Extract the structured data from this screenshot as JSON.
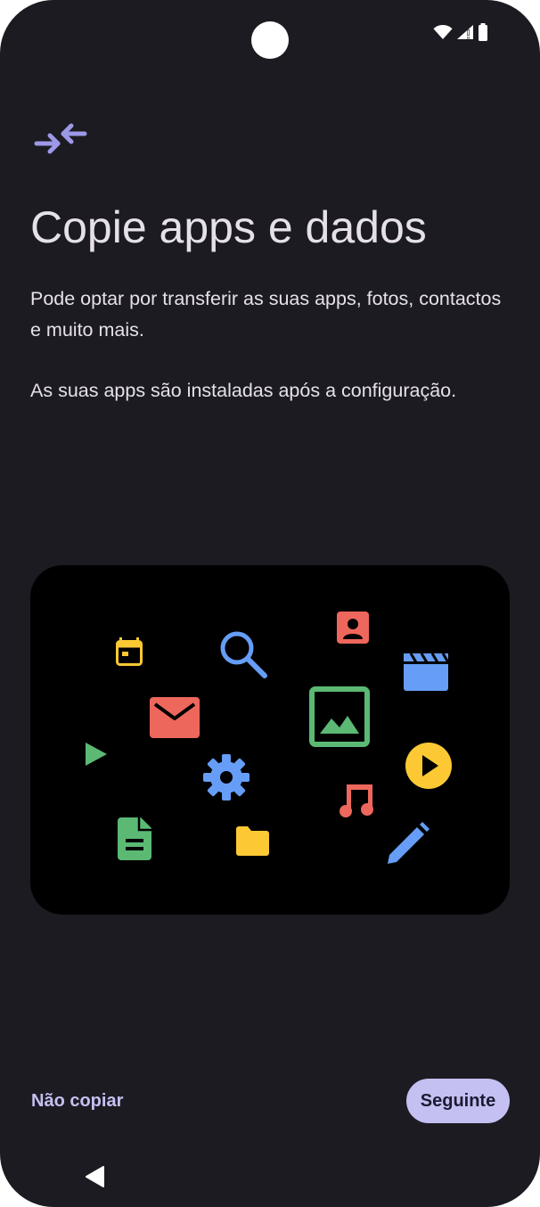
{
  "status_bar": {
    "wifi_icon": "wifi-icon",
    "signal_icon": "signal-alert-icon",
    "battery_icon": "battery-icon"
  },
  "header": {
    "icon": "transfer-arrows-icon",
    "title": "Copie apps e dados"
  },
  "body": {
    "paragraph1": "Pode optar por transferir as suas apps, fotos, contactos e muito mais.",
    "paragraph2": "As suas apps são instaladas após a configuração."
  },
  "illustration": {
    "icons": [
      "calendar-icon",
      "search-icon",
      "contact-icon",
      "video-clapper-icon",
      "mail-icon",
      "image-icon",
      "play-icon",
      "settings-gear-icon",
      "play-circle-icon",
      "music-note-icon",
      "document-icon",
      "folder-icon",
      "edit-pencil-icon"
    ]
  },
  "actions": {
    "skip_label": "Não copiar",
    "next_label": "Seguinte"
  },
  "nav": {
    "back_icon": "back-triangle-icon"
  },
  "colors": {
    "background": "#1c1b21",
    "accent": "#c4c0f2",
    "icon_accent": "#9d98e8",
    "blue": "#669df6",
    "red": "#ee675c",
    "green": "#5bb974",
    "yellow": "#fcc934"
  }
}
